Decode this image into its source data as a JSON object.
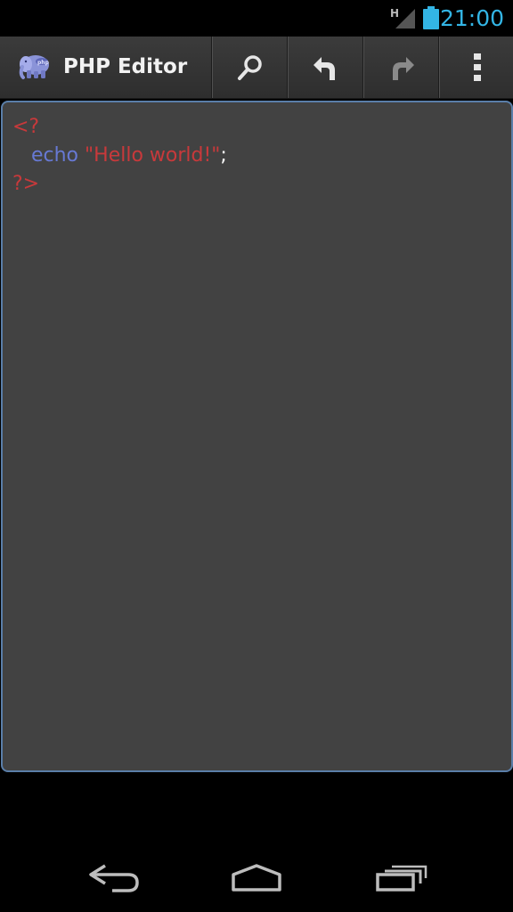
{
  "status_bar": {
    "network_type": "H",
    "time": "21:00",
    "signal_icon": "signal-icon",
    "battery_icon": "battery-icon"
  },
  "action_bar": {
    "app_icon": "php-elephant-icon",
    "title": "PHP Editor",
    "actions": [
      {
        "name": "search",
        "icon": "search-icon"
      },
      {
        "name": "undo",
        "icon": "undo-icon"
      },
      {
        "name": "redo",
        "icon": "redo-icon"
      },
      {
        "name": "overflow",
        "icon": "overflow-menu-icon"
      }
    ]
  },
  "editor": {
    "lines": [
      {
        "tokens": [
          {
            "type": "tag",
            "text": "<?"
          }
        ]
      },
      {
        "tokens": [
          {
            "type": "plain",
            "text": "   "
          },
          {
            "type": "kw",
            "text": "echo"
          },
          {
            "type": "plain",
            "text": " "
          },
          {
            "type": "str",
            "text": "\"Hello world!\""
          },
          {
            "type": "plain",
            "text": ";"
          }
        ]
      },
      {
        "tokens": [
          {
            "type": "tag",
            "text": "?>"
          }
        ]
      }
    ]
  },
  "nav_bar": {
    "buttons": [
      {
        "name": "back",
        "icon": "back-icon"
      },
      {
        "name": "home",
        "icon": "home-icon"
      },
      {
        "name": "recents",
        "icon": "recent-apps-icon"
      }
    ]
  },
  "colors": {
    "accent": "#33b5e5",
    "editor_bg": "#424242",
    "editor_border": "#5a7ea8",
    "syntax_tag": "#c8393b",
    "syntax_keyword": "#6779d4",
    "syntax_string": "#c8393b",
    "syntax_plain": "#ffffff"
  }
}
